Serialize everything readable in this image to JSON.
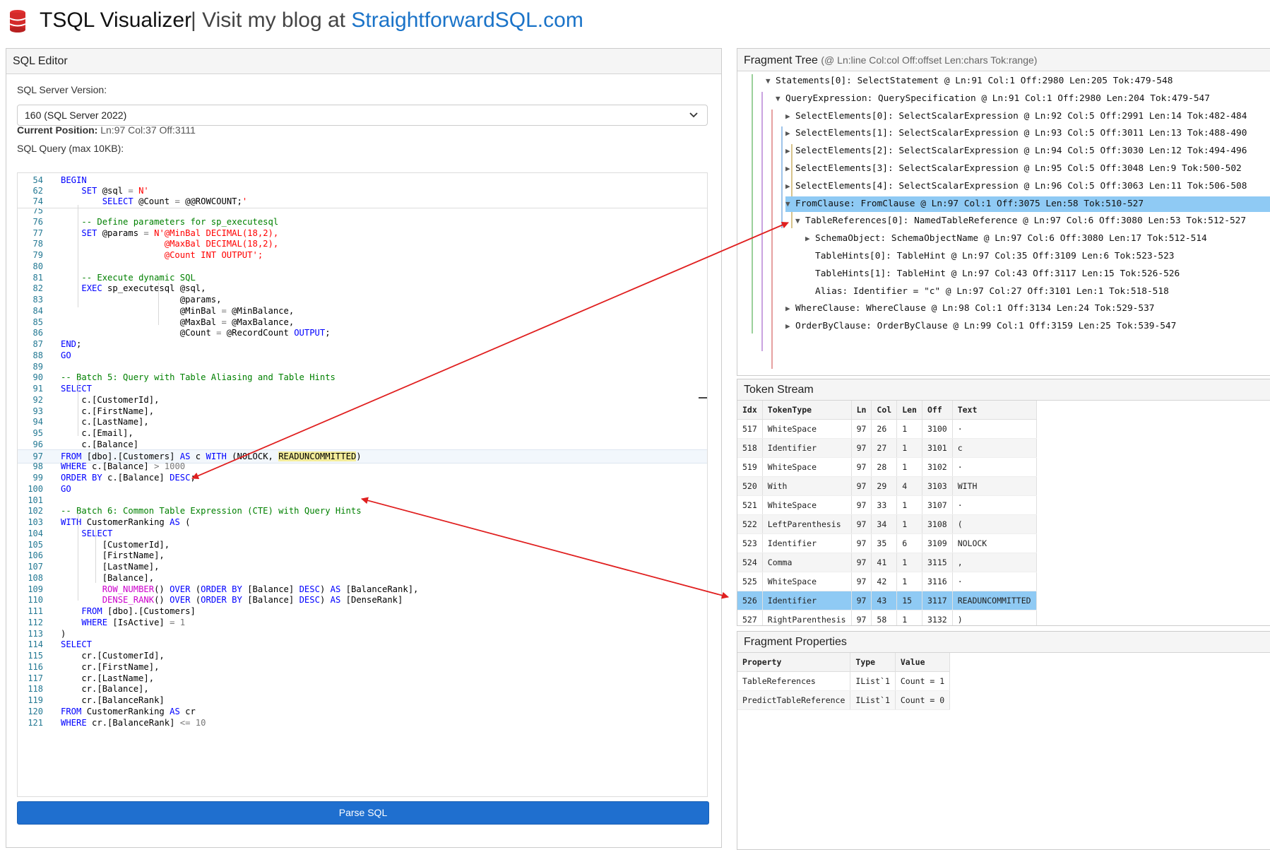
{
  "header": {
    "title": "TSQL Visualizer",
    "separator": "|",
    "blog_prefix": "Visit my blog at",
    "blog_link": "StraightforwardSQL.com"
  },
  "editor": {
    "panel_title": "SQL Editor",
    "version_label": "SQL Server Version:",
    "version_value": "160 (SQL Server 2022)",
    "position_label": "Current Position:",
    "position_value": "Ln:97 Col:37 Off:3111",
    "query_label": "SQL Query (max 10KB):",
    "parse_button": "Parse SQL",
    "sticky_lines": [
      {
        "n": "54",
        "t": "BEGIN"
      },
      {
        "n": "62",
        "t": "    SET @sql = N'"
      },
      {
        "n": "74",
        "t": "        SELECT @Count = @@ROWCOUNT;'"
      }
    ],
    "lines": [
      {
        "n": "75",
        "t": ""
      },
      {
        "n": "76",
        "t": "    -- Define parameters for sp_executesql"
      },
      {
        "n": "77",
        "t": "    SET @params = N'@MinBal DECIMAL(18,2),"
      },
      {
        "n": "78",
        "t": "                    @MaxBal DECIMAL(18,2),"
      },
      {
        "n": "79",
        "t": "                    @Count INT OUTPUT';"
      },
      {
        "n": "80",
        "t": ""
      },
      {
        "n": "81",
        "t": "    -- Execute dynamic SQL"
      },
      {
        "n": "82",
        "t": "    EXEC sp_executesql @sql,"
      },
      {
        "n": "83",
        "t": "                       @params,"
      },
      {
        "n": "84",
        "t": "                       @MinBal = @MinBalance,"
      },
      {
        "n": "85",
        "t": "                       @MaxBal = @MaxBalance,"
      },
      {
        "n": "86",
        "t": "                       @Count = @RecordCount OUTPUT;"
      },
      {
        "n": "87",
        "t": "END;"
      },
      {
        "n": "88",
        "t": "GO"
      },
      {
        "n": "89",
        "t": ""
      },
      {
        "n": "90",
        "t": "-- Batch 5: Query with Table Aliasing and Table Hints"
      },
      {
        "n": "91",
        "t": "SELECT"
      },
      {
        "n": "92",
        "t": "    c.[CustomerId],"
      },
      {
        "n": "93",
        "t": "    c.[FirstName],"
      },
      {
        "n": "94",
        "t": "    c.[LastName],"
      },
      {
        "n": "95",
        "t": "    c.[Email],"
      },
      {
        "n": "96",
        "t": "    c.[Balance]"
      },
      {
        "n": "97",
        "t": "FROM [dbo].[Customers] AS c WITH (NOLOCK, READUNCOMMITTED)"
      },
      {
        "n": "98",
        "t": "WHERE c.[Balance] > 1000"
      },
      {
        "n": "99",
        "t": "ORDER BY c.[Balance] DESC;"
      },
      {
        "n": "100",
        "t": "GO"
      },
      {
        "n": "101",
        "t": ""
      },
      {
        "n": "102",
        "t": "-- Batch 6: Common Table Expression (CTE) with Query Hints"
      },
      {
        "n": "103",
        "t": "WITH CustomerRanking AS ("
      },
      {
        "n": "104",
        "t": "    SELECT"
      },
      {
        "n": "105",
        "t": "        [CustomerId],"
      },
      {
        "n": "106",
        "t": "        [FirstName],"
      },
      {
        "n": "107",
        "t": "        [LastName],"
      },
      {
        "n": "108",
        "t": "        [Balance],"
      },
      {
        "n": "109",
        "t": "        ROW_NUMBER() OVER (ORDER BY [Balance] DESC) AS [BalanceRank],"
      },
      {
        "n": "110",
        "t": "        DENSE_RANK() OVER (ORDER BY [Balance] DESC) AS [DenseRank]"
      },
      {
        "n": "111",
        "t": "    FROM [dbo].[Customers]"
      },
      {
        "n": "112",
        "t": "    WHERE [IsActive] = 1"
      },
      {
        "n": "113",
        "t": ")"
      },
      {
        "n": "114",
        "t": "SELECT"
      },
      {
        "n": "115",
        "t": "    cr.[CustomerId],"
      },
      {
        "n": "116",
        "t": "    cr.[FirstName],"
      },
      {
        "n": "117",
        "t": "    cr.[LastName],"
      },
      {
        "n": "118",
        "t": "    cr.[Balance],"
      },
      {
        "n": "119",
        "t": "    cr.[BalanceRank]"
      },
      {
        "n": "120",
        "t": "FROM CustomerRanking AS cr"
      },
      {
        "n": "121",
        "t": "WHERE cr.[BalanceRank] <= 10"
      }
    ]
  },
  "tree": {
    "panel_title": "Fragment Tree",
    "panel_subtitle": "(@ Ln:line Col:col Off:offset Len:chars Tok:range)",
    "nodes": [
      {
        "indent": 0,
        "arrow": "▼",
        "text": "Statements[0]: SelectStatement @ Ln:91 Col:1 Off:2980 Len:205 Tok:479-548"
      },
      {
        "indent": 1,
        "arrow": "▼",
        "text": "QueryExpression: QuerySpecification @ Ln:91 Col:1 Off:2980 Len:204 Tok:479-547"
      },
      {
        "indent": 2,
        "arrow": "▶",
        "text": "SelectElements[0]: SelectScalarExpression @ Ln:92 Col:5 Off:2991 Len:14 Tok:482-484"
      },
      {
        "indent": 2,
        "arrow": "▶",
        "text": "SelectElements[1]: SelectScalarExpression @ Ln:93 Col:5 Off:3011 Len:13 Tok:488-490"
      },
      {
        "indent": 2,
        "arrow": "▶",
        "text": "SelectElements[2]: SelectScalarExpression @ Ln:94 Col:5 Off:3030 Len:12 Tok:494-496"
      },
      {
        "indent": 2,
        "arrow": "▶",
        "text": "SelectElements[3]: SelectScalarExpression @ Ln:95 Col:5 Off:3048 Len:9 Tok:500-502"
      },
      {
        "indent": 2,
        "arrow": "▶",
        "text": "SelectElements[4]: SelectScalarExpression @ Ln:96 Col:5 Off:3063 Len:11 Tok:506-508"
      },
      {
        "indent": 2,
        "arrow": "▼",
        "text": "FromClause: FromClause @ Ln:97 Col:1 Off:3075 Len:58 Tok:510-527",
        "active": true
      },
      {
        "indent": 3,
        "arrow": "▼",
        "text": "TableReferences[0]: NamedTableReference @ Ln:97 Col:6 Off:3080 Len:53 Tok:512-527"
      },
      {
        "indent": 4,
        "arrow": "▶",
        "text": "SchemaObject: SchemaObjectName @ Ln:97 Col:6 Off:3080 Len:17 Tok:512-514"
      },
      {
        "indent": 4,
        "arrow": "",
        "text": "TableHints[0]: TableHint @ Ln:97 Col:35 Off:3109 Len:6 Tok:523-523"
      },
      {
        "indent": 4,
        "arrow": "",
        "text": "TableHints[1]: TableHint @ Ln:97 Col:43 Off:3117 Len:15 Tok:526-526"
      },
      {
        "indent": 4,
        "arrow": "",
        "text": "Alias: Identifier = \"c\" @ Ln:97 Col:27 Off:3101 Len:1 Tok:518-518"
      },
      {
        "indent": 2,
        "arrow": "▶",
        "text": "WhereClause: WhereClause @ Ln:98 Col:1 Off:3134 Len:24 Tok:529-537"
      },
      {
        "indent": 2,
        "arrow": "▶",
        "text": "OrderByClause: OrderByClause @ Ln:99 Col:1 Off:3159 Len:25 Tok:539-547"
      }
    ]
  },
  "tokens": {
    "panel_title": "Token Stream",
    "headers": [
      "Idx",
      "TokenType",
      "Ln",
      "Col",
      "Len",
      "Off",
      "Text"
    ],
    "rows": [
      [
        "517",
        "WhiteSpace",
        "97",
        "26",
        "1",
        "3100",
        "·"
      ],
      [
        "518",
        "Identifier",
        "97",
        "27",
        "1",
        "3101",
        "c"
      ],
      [
        "519",
        "WhiteSpace",
        "97",
        "28",
        "1",
        "3102",
        "·"
      ],
      [
        "520",
        "With",
        "97",
        "29",
        "4",
        "3103",
        "WITH"
      ],
      [
        "521",
        "WhiteSpace",
        "97",
        "33",
        "1",
        "3107",
        "·"
      ],
      [
        "522",
        "LeftParenthesis",
        "97",
        "34",
        "1",
        "3108",
        "("
      ],
      [
        "523",
        "Identifier",
        "97",
        "35",
        "6",
        "3109",
        "NOLOCK"
      ],
      [
        "524",
        "Comma",
        "97",
        "41",
        "1",
        "3115",
        ","
      ],
      [
        "525",
        "WhiteSpace",
        "97",
        "42",
        "1",
        "3116",
        "·"
      ],
      [
        "526",
        "Identifier",
        "97",
        "43",
        "15",
        "3117",
        "READUNCOMMITTED"
      ],
      [
        "527",
        "RightParenthesis",
        "97",
        "58",
        "1",
        "3132",
        ")"
      ]
    ],
    "active_index": 9
  },
  "properties": {
    "panel_title": "Fragment Properties",
    "headers": [
      "Property",
      "Type",
      "Value"
    ],
    "rows": [
      [
        "TableReferences",
        "IList`1",
        "Count = 1"
      ],
      [
        "PredictTableReference",
        "IList`1",
        "Count = 0"
      ]
    ]
  },
  "colors": {
    "accent": "#1f6fcf",
    "selection": "#8fcaf4",
    "annotation_arrow": "#e02020"
  },
  "icons": {
    "logo": "database-stack-icon",
    "expanded": "triangle-down-icon",
    "collapsed": "triangle-right-icon",
    "select_chevron": "chevron-down-icon"
  }
}
